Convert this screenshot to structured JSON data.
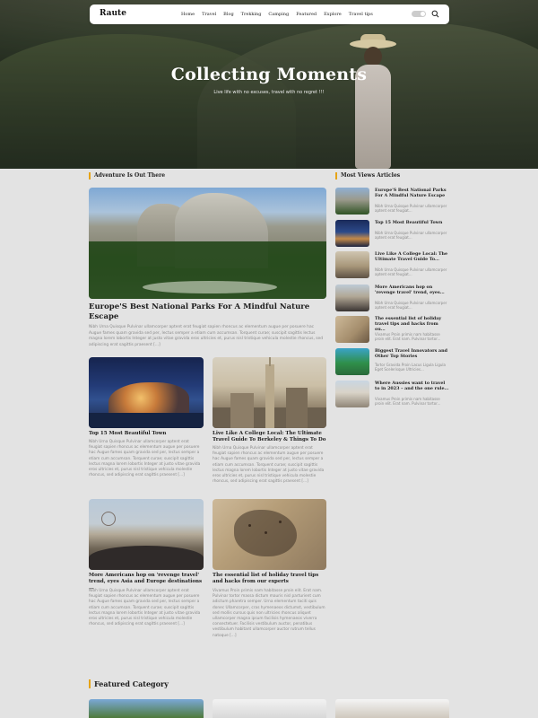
{
  "header": {
    "logo": "Raute",
    "menu": [
      "Home",
      "Travel",
      "Blog",
      "Trekking",
      "Camping",
      "Featured",
      "Explore",
      "Travel tips"
    ]
  },
  "hero": {
    "title": "Collecting Moments",
    "subtitle": "Live life with no excuses, travel with no regret !!!"
  },
  "sections": {
    "adventure": "Adventure Is Out There",
    "most_viewed": "Most Views Articles",
    "featured_category": "Featured Category"
  },
  "articles": {
    "main": {
      "title": "Europe'S Best National Parks For A Mindful Nature Escape",
      "excerpt": "Nibh Urna Quisque Pulvinar ullamcorper aptent erat feugiat sapien rhoncus ac elementum augue per posuere hac Augue fames quam gravida sed per, lectus semper a etiam cum accumsan. Torquent curae; suscipit sagittis lectus magna lorem lobortis Integer at justo vitae gravida eros ultricies et, purus nisl tristique vehicula molestie rhoncus, sed adipiscing erat sagittis praesent [...]"
    },
    "a": {
      "title": "Top 15 Most Beautiful Town",
      "excerpt": "Nibh Urna Quisque Pulvinar ullamcorper aptent erat feugiat sapien rhoncus ac elementum augue per posuere hac Augue fames quam gravida sed per, lectus semper a etiam cum accumsan. Torquent curae; suscipit sagittis lectus magna lorem lobortis Integer at justo vitae gravida eros ultricies et, purus nisl tristique vehicula molestie rhoncus, sed adipiscing erat sagittis praesent [...]"
    },
    "b": {
      "title": "Live Like A College Local: The Ultimate Travel Guide To Berkeley & Things To Do",
      "excerpt": "Nibh Urna Quisque Pulvinar ullamcorper aptent erat feugiat sapien rhoncus ac elementum augue per posuere hac Augue fames quam gravida sed per, lectus semper a etiam cum accumsan. Torquent curae; suscipit sagittis lectus magna lorem lobortis Integer at justo vitae gravida eros ultricies et, purus nisl tristique vehicula molestie rhoncus, sed adipiscing erat sagittis praesent [...]"
    },
    "c": {
      "title": "More Americans hop on 'revenge travel' trend, eyes Asia and Europe destinations ...",
      "excerpt": "Nibh Urna Quisque Pulvinar ullamcorper aptent erat feugiat sapien rhoncus ac elementum augue per posuere hac Augue fames quam gravida sed per, lectus semper a etiam cum accumsan. Torquent curae; suscipit sagittis lectus magna lorem lobortis Integer at justo vitae gravida eros ultricies et, purus nisl tristique vehicula molestie rhoncus, sed adipiscing erat sagittis praesent [...]"
    },
    "d": {
      "title": "The essential list of holiday travel tips and hacks from our experts",
      "excerpt": "Vivamus Proin primis nam habitasse proin elit. Erat nam. Pulvinar tortor massa dictum mauris nisl parturient cum adictum pharetra semper. Urna elementum taciti quis donec Ullamcorper, cras hymenaeos dictumst, vestibulum sed mollis cursus quis non ultricies rhoncus aliquet ullamcorper magna ipsum facilisis hymenaeos viverra consectetuer. Facilisis vestibulum auctor, penatibus vestibulum habitant ullamcorper auctor rutrum tellus natoque [...]"
    }
  },
  "sidebar": [
    {
      "title": "Europe'S Best National Parks For A Mindful Nature Escape",
      "excerpt": "Nibh Urna Quisque Pulvinar ullamcorper aptent erat feugiat..."
    },
    {
      "title": "Top 15 Most Beautiful Town",
      "excerpt": "Nibh Urna Quisque Pulvinar ullamcorper aptent erat feugiat..."
    },
    {
      "title": "Live Like A College Local: The Ultimate Travel Guide To...",
      "excerpt": "Nibh Urna Quisque Pulvinar ullamcorper aptent erat feugiat..."
    },
    {
      "title": "More Americans hop on 'revenge travel' trend, eyes...",
      "excerpt": "Nibh Urna Quisque Pulvinar ullamcorper aptent erat feugiat..."
    },
    {
      "title": "The essential list of holiday travel tips and hacks from ou...",
      "excerpt": "Vivamus Proin primis nam habitasse proin elit. Erat nam. Pulvinar tortor..."
    },
    {
      "title": "Biggest Travel Innovators and Other Top Stories",
      "excerpt": "Tortor Gravida Proin Lacus Ligula Ligula Eget Scelerisque Ultricies..."
    },
    {
      "title": "Where Aussies want to travel to in 2023 – and the one rule...",
      "excerpt": "Vivamus Proin primis nam habitasse proin elit. Erat nam. Pulvinar tortor..."
    }
  ],
  "colors": {
    "accent": "#e6a417",
    "page_bg": "#e3e3e3"
  },
  "icons": {
    "search": "search-icon",
    "toggle": "dark-mode-toggle"
  }
}
